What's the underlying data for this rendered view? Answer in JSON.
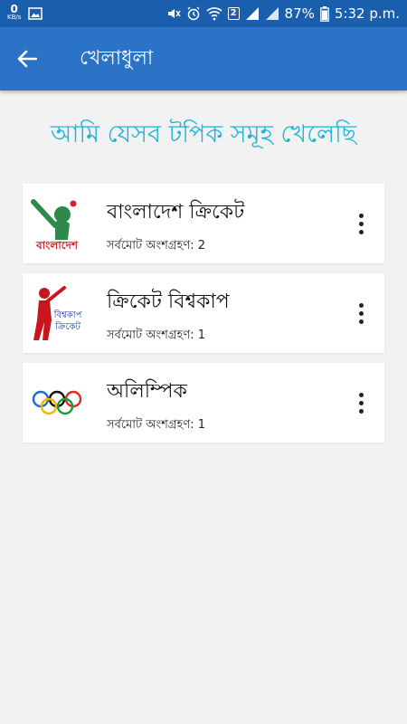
{
  "status_bar": {
    "data_speed_value": "0",
    "data_speed_unit": "KB/s",
    "sim_label": "2",
    "battery": "87%",
    "time": "5:32 p.m."
  },
  "app_bar": {
    "title": "খেলাধুলা",
    "back_icon": "arrow-back-icon"
  },
  "heading": "আমি যেসব টপিক সমূহ খেলেছি",
  "topics": [
    {
      "name": "বাংলাদেশ ক্রিকেট",
      "participation_label": "সর্বমোট অংশগ্রহণ:",
      "participation_count": "2",
      "thumb_text": "বাংলাদেশ",
      "icon": "bangladesh-cricket-thumbnail"
    },
    {
      "name": "ক্রিকেট বিশ্বকাপ",
      "participation_label": "সর্বমোট অংশগ্রহণ:",
      "participation_count": "1",
      "thumb_text_line1": "বিশ্বকাপ",
      "thumb_text_line2": "ক্রিকেট",
      "icon": "cricket-worldcup-thumbnail"
    },
    {
      "name": "অলিম্পিক",
      "participation_label": "সর্বমোট অংশগ্রহণ:",
      "participation_count": "1",
      "icon": "olympic-rings-thumbnail"
    }
  ],
  "colors": {
    "status_bar": "#1a5fae",
    "app_bar": "#2a73c6",
    "heading": "#1fb3d6",
    "background": "#f2f2f2"
  }
}
